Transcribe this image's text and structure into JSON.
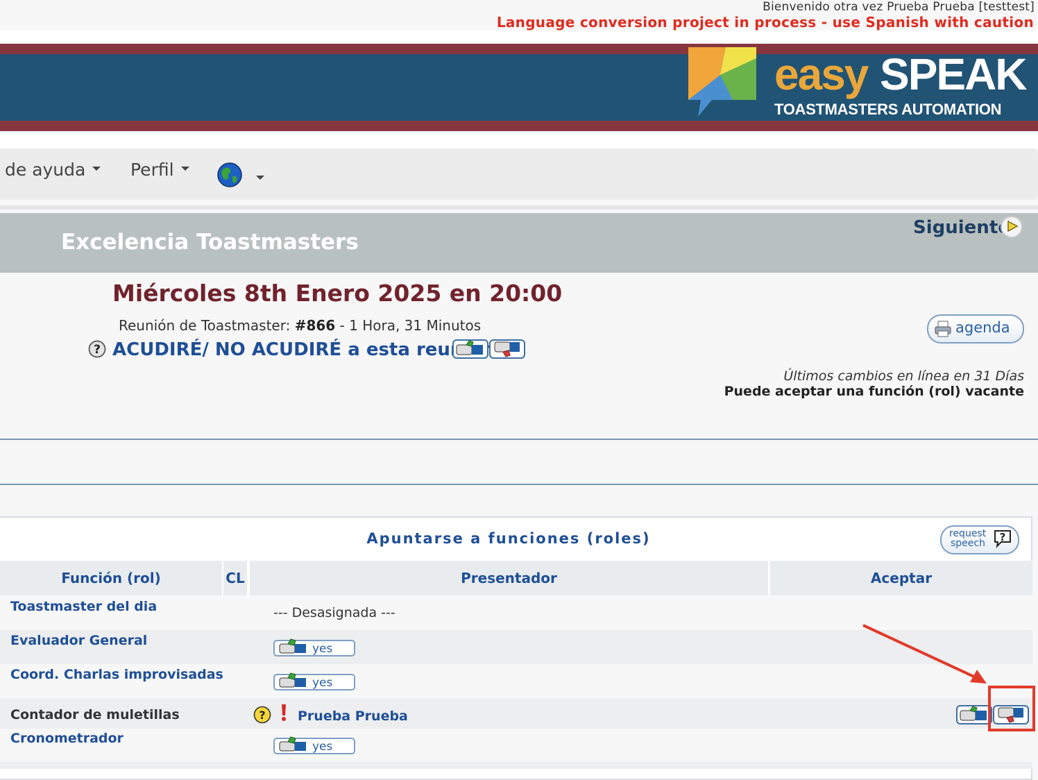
{
  "topbar": {
    "welcome": "Bienvenido otra vez Prueba Prueba  [testtest]",
    "warning": "Language conversion project in process - use Spanish with caution"
  },
  "logo": {
    "easy": "easy",
    "speak": "SPEAK",
    "tagline": "TOASTMASTERS AUTOMATION"
  },
  "nav": {
    "help": "de ayuda",
    "profile": "Perfil",
    "language_icon": "globe-icon"
  },
  "club": {
    "name": "Excelencia Toastmasters",
    "next": "Siguiente"
  },
  "meeting": {
    "date": "Miércoles 8th Enero 2025 en 20:00",
    "info_prefix": "Reunión de Toastmaster: ",
    "number": "#866",
    "info_suffix": " - 1 Hora, 31 Minutos",
    "attend_link": "ACUDIRÉ/ NO ACUDIRÉ a esta reunión",
    "agenda_label": "agenda",
    "last_changes": "Últimos cambios en línea en 31 Días",
    "vacant": "Puede aceptar una función (rol) vacante"
  },
  "roles": {
    "title": "Apuntarse a funciones (roles)",
    "request_speech_line1": "request",
    "request_speech_line2": "speech",
    "headers": {
      "role": "Función (rol)",
      "cl": "CL",
      "presenter": "Presentador",
      "accept": "Aceptar"
    },
    "rows": [
      {
        "role": "Toastmaster del dia",
        "presenter": "--- Desasignada ---"
      },
      {
        "role": "Evaluador General",
        "button": "yes"
      },
      {
        "role": "Coord. Charlas improvisadas",
        "button": "yes"
      },
      {
        "role": "Contador de muletillas",
        "presenter": "Prueba Prueba"
      },
      {
        "role": "Cronometrador",
        "button": "yes"
      }
    ]
  },
  "colors": {
    "banner_blue": "#215374",
    "banner_maroon": "#873640",
    "warning_red": "#e02b20",
    "link_blue": "#1f4f96",
    "date_maroon": "#70232d",
    "highlight_red": "#e23a2a"
  }
}
